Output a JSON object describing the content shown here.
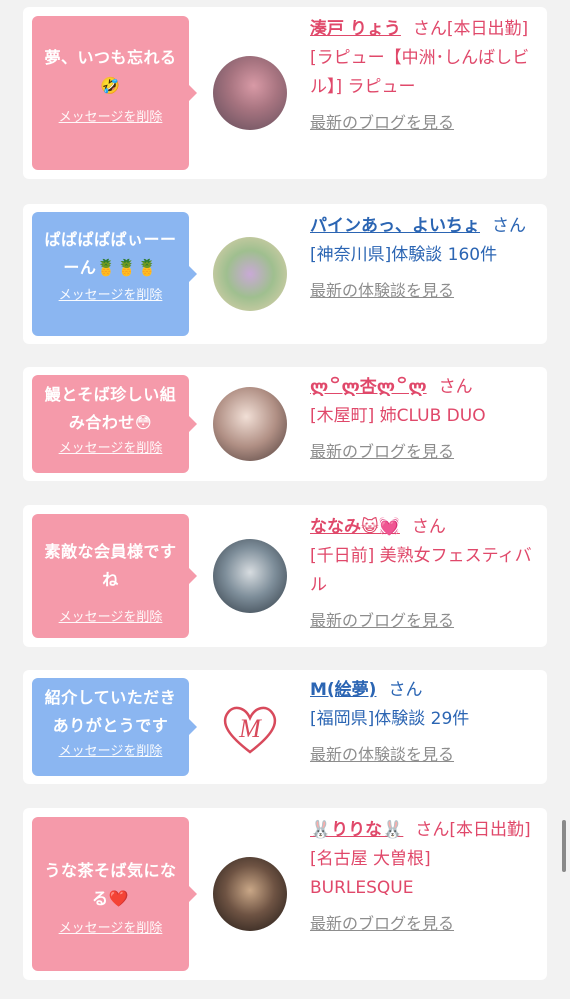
{
  "cards": [
    {
      "message": "夢、いつも忘れる🤣",
      "delete_label": "メッセージを削除",
      "name": "湊戸 りょう",
      "san": "さん[本日出勤]",
      "region": "[ラピュー【中洲･しんばしビル】] ラピュー",
      "link": "最新のブログを見る"
    },
    {
      "message": "ぱぱぱぱぱぃーーーん🍍🍍🍍",
      "delete_label": "メッセージを削除",
      "name": "パインあっ、よいちょ",
      "san": "さん",
      "region": "[神奈川県]体験談 160件",
      "link": "最新の体験談を見る"
    },
    {
      "message": "鰻とそば珍しい組み合わせ😳",
      "delete_label": "メッセージを削除",
      "name": "ლ꒪ლ杏ლ꒪ლ",
      "san": "さん",
      "region": "[木屋町] 姉CLUB DUO",
      "link": "最新のブログを見る"
    },
    {
      "message": "素敵な会員様ですね",
      "delete_label": "メッセージを削除",
      "name": "ななみ😺💓",
      "san": "さん",
      "region": "[千日前] 美熟女フェスティバル",
      "link": "最新のブログを見る"
    },
    {
      "message": "紹介していただきありがとうです",
      "delete_label": "メッセージを削除",
      "name": "M(絵夢)",
      "san": "さん",
      "region": "[福岡県]体験談 29件",
      "link": "最新の体験談を見る"
    },
    {
      "message": "うな茶そば気になる❤️",
      "delete_label": "メッセージを削除",
      "name": "🐰りりな🐰",
      "san": "さん[本日出勤]",
      "region": "[名古屋 大曽根] BURLESQUE",
      "link": "最新のブログを見る"
    }
  ],
  "icons": {
    "avatar_5": "heart-m-logo-icon"
  },
  "colors": {
    "pink_bubble": "#f59aaa",
    "blue_bubble": "#8bb6f1",
    "pink_text": "#e0486a",
    "blue_text": "#2b65b3",
    "gray_link": "#8d8d8d"
  }
}
